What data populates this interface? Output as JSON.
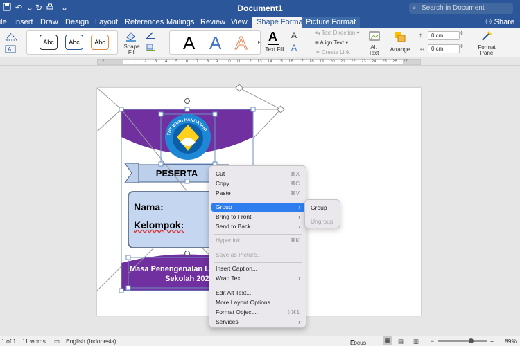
{
  "app": {
    "doc_title": "Document1",
    "search_placeholder": "Search in Document"
  },
  "tabs": [
    {
      "label": "File"
    },
    {
      "label": "Insert"
    },
    {
      "label": "Draw"
    },
    {
      "label": "Design"
    },
    {
      "label": "Layout"
    },
    {
      "label": "References"
    },
    {
      "label": "Mailings"
    },
    {
      "label": "Review"
    },
    {
      "label": "View"
    },
    {
      "label": "Shape Format"
    },
    {
      "label": "Picture Format"
    }
  ],
  "share_label": "Share",
  "ribbon": {
    "shape_styles": [
      "Abc",
      "Abc",
      "Abc"
    ],
    "shape_fill_label": "Shape Fill",
    "text_fill_label": "Text Fill",
    "wordart_letter": "A",
    "text_direction_label": "Text Direction",
    "align_text_label": "Align Text",
    "create_link_label": "Create Link",
    "alt_text_label": "Alt Text",
    "arrange_label": "Arrange",
    "height_value": "0 cm",
    "width_value": "0 cm",
    "format_pane_label": "Format Pane"
  },
  "ruler_ticks": [
    "2",
    "1",
    "1",
    "2",
    "3",
    "4",
    "5",
    "6",
    "7",
    "8",
    "9",
    "10",
    "11",
    "12",
    "13",
    "14",
    "15",
    "16",
    "17",
    "18",
    "19",
    "20",
    "21",
    "22",
    "23",
    "24",
    "25",
    "26",
    "27"
  ],
  "document": {
    "peserta": "PESERTA",
    "logo_text": "TUT WURI HANDAYANI",
    "nama_label": "Nama:",
    "kelompok_label": "Kelompok:",
    "footer_line1": "Masa Penengenalan Lin",
    "footer_line2": "Sekolah 2023"
  },
  "context_menu": {
    "items": [
      {
        "label": "Cut",
        "shortcut": "⌘X"
      },
      {
        "label": "Copy",
        "shortcut": "⌘C"
      },
      {
        "label": "Paste",
        "shortcut": "⌘V"
      },
      {
        "label": "Group",
        "arrow": "›"
      },
      {
        "label": "Bring to Front",
        "arrow": "›"
      },
      {
        "label": "Send to Back",
        "arrow": "›"
      },
      {
        "label": "Hyperlink...",
        "shortcut": "⌘K"
      },
      {
        "label": "Save as Picture..."
      },
      {
        "label": "Insert Caption..."
      },
      {
        "label": "Wrap Text",
        "arrow": "›"
      },
      {
        "label": "Edit Alt Text..."
      },
      {
        "label": "More Layout Options..."
      },
      {
        "label": "Format Object...",
        "shortcut": "⇧⌘1"
      },
      {
        "label": "Services",
        "arrow": "›"
      }
    ],
    "submenu": [
      "Group",
      "Ungroup"
    ]
  },
  "status": {
    "page": "1 of 1",
    "words": "11 words",
    "language": "English (Indonesia)",
    "focus": "Focus",
    "zoom": "89%"
  }
}
